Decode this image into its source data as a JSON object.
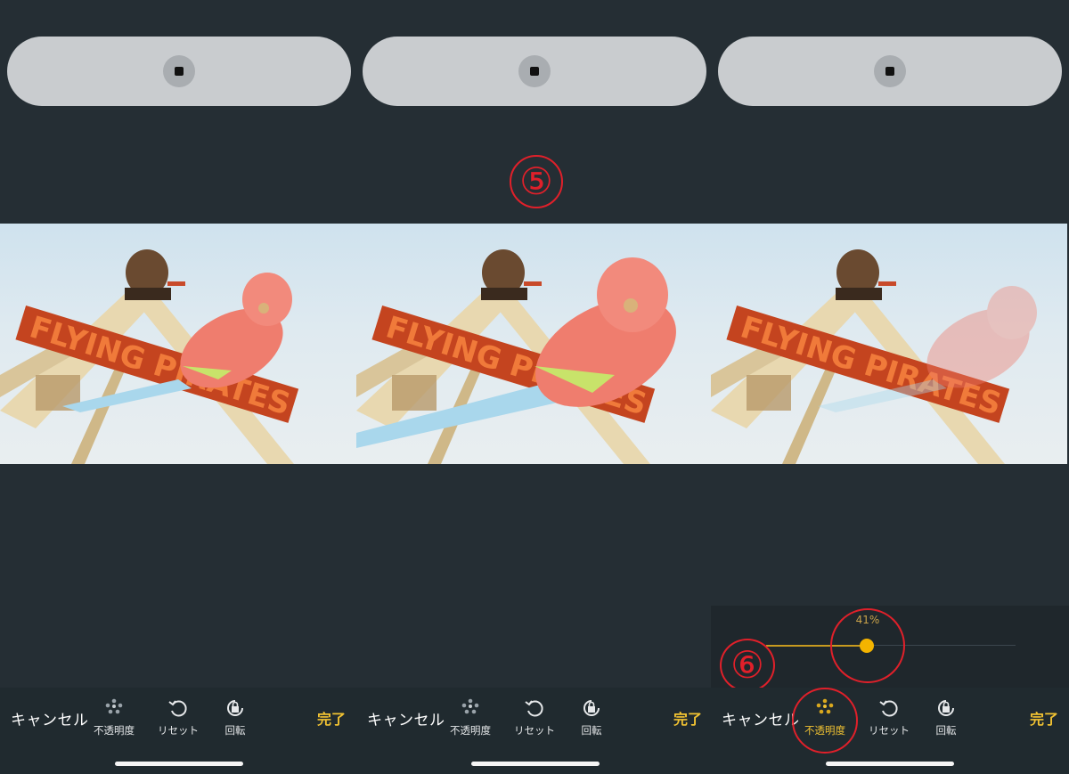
{
  "annotations": {
    "step5": "⑤",
    "step6": "⑥"
  },
  "photo_sign_text": "FLYING PIRATES",
  "panels": [
    {
      "bottom": {
        "cancel": "キャンセル",
        "opacity": "不透明度",
        "reset": "リセット",
        "rotate": "回転",
        "done": "完了"
      }
    },
    {
      "bottom": {
        "cancel": "キャンセル",
        "opacity": "不透明度",
        "reset": "リセット",
        "rotate": "回転",
        "done": "完了"
      }
    },
    {
      "bottom": {
        "cancel": "キャンセル",
        "opacity": "不透明度",
        "reset": "リセット",
        "rotate": "回転",
        "done": "完了"
      },
      "slider": {
        "label": "41%",
        "value": 0.41
      }
    }
  ],
  "colors": {
    "accent": "#f1c232",
    "annotation": "#e0202a",
    "background": "#252e34"
  },
  "icons": {
    "opacity": "dots-cluster-icon",
    "reset": "rotate-ccw-icon",
    "rotate": "lock-rotate-icon",
    "camera": "camera-dot-icon"
  }
}
